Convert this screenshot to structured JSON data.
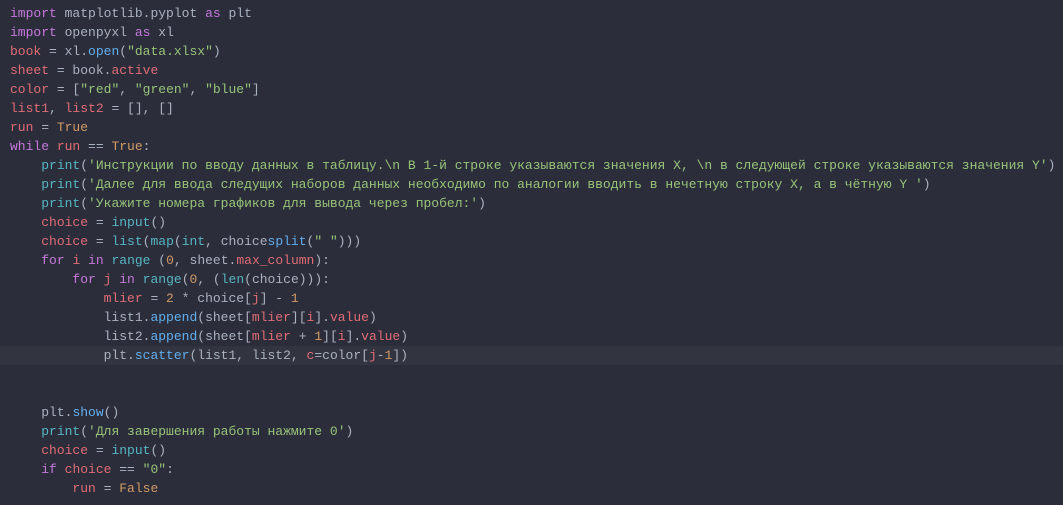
{
  "code": {
    "l1": {
      "kw": "import",
      "mod": "matplotlib.pyplot",
      "as": "as",
      "alias": "plt"
    },
    "l2": {
      "kw": "import",
      "mod": "openpyxl",
      "as": "as",
      "alias": "xl"
    },
    "l3": {
      "var": "book",
      "eq": " = ",
      "obj": "xl",
      "dot": ".",
      "fn": "open",
      "op": "(",
      "str": "\"data.xlsx\"",
      "cp": ")"
    },
    "l4": {
      "var": "sheet",
      "eq": " = ",
      "obj": "book",
      "dot": ".",
      "attr": "active"
    },
    "l5": {
      "var": "color",
      "eq": " = [",
      "s1": "\"red\"",
      "c1": ", ",
      "s2": "\"green\"",
      "c2": ", ",
      "s3": "\"blue\"",
      "close": "]"
    },
    "l6": {
      "v1": "list1",
      "c": ", ",
      "v2": "list2",
      "eq": " = [], []"
    },
    "l7": {
      "var": "run",
      "eq": " = ",
      "val": "True"
    },
    "l8": {
      "kw": "while",
      "sp": " ",
      "var": "run",
      "eq": " == ",
      "val": "True",
      "colon": ":"
    },
    "l9": {
      "fn": "print",
      "op": "(",
      "str": "'Инструкции по вводу данных в таблицу.\\n В 1-й строке указываются значения X, \\n в следующей строке указываются значения Y'",
      "cp": ")"
    },
    "l10": {
      "fn": "print",
      "op": "(",
      "str": "'Далее для ввода следущих наборов данных необходимо по аналогии вводить в нечетную строку X, а в чётную Y '",
      "cp": ")"
    },
    "l11": {
      "fn": "print",
      "op": "(",
      "str": "'Укажите номера графиков для вывода через пробел:'",
      "cp": ")"
    },
    "l12": {
      "var": "choice",
      "eq": " = ",
      "fn": "input",
      "parens": "()"
    },
    "l13": {
      "var": "choice",
      "eq": " = ",
      "fn1": "list",
      "op1": "(",
      "fn2": "map",
      "op2": "(",
      "intt": "int",
      ", ": ", ",
      "obj": "choice",
      ".": ".",
      "split": "split",
      "op3": "(",
      "sp": "\" \"",
      "cp": ")))"
    },
    "l14": {
      "kw": "for",
      "sp": " ",
      "i": "i",
      "in": " in ",
      "fn": "range",
      "sp2": " (",
      "n0": "0",
      "c": ", ",
      "obj": "sheet",
      "dot": ".",
      "attr": "max_column",
      "cp": "):"
    },
    "l15": {
      "kw": "for",
      "sp": " ",
      "j": "j",
      "in": " in ",
      "fn": "range",
      "op": "(",
      "n0": "0",
      "c": ", (",
      "len": "len",
      "op2": "(",
      "obj": "choice",
      "cp": "))):"
    },
    "l16": {
      "var": "mlier",
      "eq": " = ",
      "n2": "2",
      "mul": " * ",
      "obj": "choice",
      "br": "[",
      "j": "j",
      "cb": "] - ",
      "n1": "1"
    },
    "l17": {
      "obj": "list1",
      "dot": ".",
      "fn": "append",
      "op": "(",
      "sh": "sheet",
      "b1": "[",
      "ml": "mlier",
      "b2": "][",
      "i": "i",
      "b3": "].",
      "val": "value",
      "cp": ")"
    },
    "l18": {
      "obj": "list2",
      "dot": ".",
      "fn": "append",
      "op": "(",
      "sh": "sheet",
      "b1": "[",
      "ml": "mlier",
      "plus": " + ",
      "n1": "1",
      "b2": "][",
      "i": "i",
      "b3": "].",
      "val": "value",
      "cp": ")"
    },
    "l19": {
      "obj": "plt",
      "dot": ".",
      "fn": "scatter",
      "op": "(",
      "l1": "list1",
      "c1": ", ",
      "l2": "list2",
      "c2": ", ",
      "kw": "c",
      "eq": "=",
      "col": "color",
      "br": "[",
      "j": "j",
      "minus": "-",
      "n1": "1",
      "cb": "])"
    },
    "l20": {
      "obj": "plt",
      "dot": ".",
      "fn": "show",
      "parens": "()"
    },
    "l21": {
      "fn": "print",
      "op": "(",
      "str": "'Для завершения работы нажмите 0'",
      "cp": ")"
    },
    "l22": {
      "var": "choice",
      "eq": " = ",
      "fn": "input",
      "parens": "()"
    },
    "l23": {
      "kw": "if",
      "sp": " ",
      "var": "choice",
      "eq": " == ",
      "str": "\"0\"",
      "colon": ":"
    },
    "l24": {
      "var": "run",
      "eq": " = ",
      "val": "False"
    }
  }
}
